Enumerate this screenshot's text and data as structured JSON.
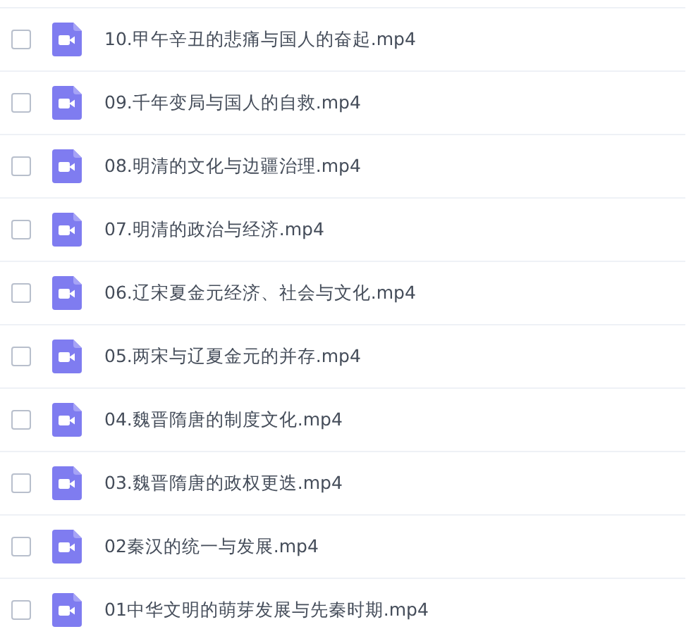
{
  "files": [
    {
      "name": "10.甲午辛丑的悲痛与国人的奋起.mp4",
      "checked": false
    },
    {
      "name": "09.千年变局与国人的自救.mp4",
      "checked": false
    },
    {
      "name": "08.明清的文化与边疆治理.mp4",
      "checked": false
    },
    {
      "name": "07.明清的政治与经济.mp4",
      "checked": false
    },
    {
      "name": "06.辽宋夏金元经济、社会与文化.mp4",
      "checked": false
    },
    {
      "name": "05.两宋与辽夏金元的并存.mp4",
      "checked": false
    },
    {
      "name": "04.魏晋隋唐的制度文化.mp4",
      "checked": false
    },
    {
      "name": "03.魏晋隋唐的政权更迭.mp4",
      "checked": false
    },
    {
      "name": "02秦汉的统一与发展.mp4",
      "checked": false
    },
    {
      "name": "01中华文明的萌芽发展与先秦时期.mp4",
      "checked": false
    }
  ]
}
